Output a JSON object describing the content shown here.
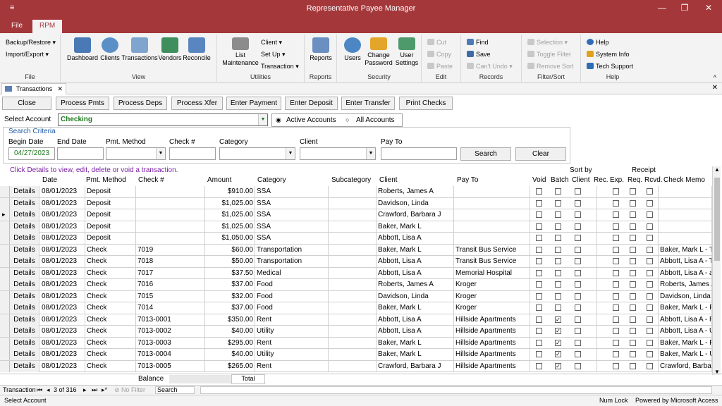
{
  "window": {
    "title": "Representative Payee Manager",
    "qa": "≡"
  },
  "menu": {
    "file": "File",
    "rpm": "RPM"
  },
  "ribbon": {
    "file_group": {
      "backup": "Backup/Restore",
      "import": "Import/Export",
      "label": "File"
    },
    "view_group": {
      "items": [
        "Dashboard",
        "Clients",
        "Transactions",
        "Vendors",
        "Reconcile"
      ],
      "label": "View"
    },
    "utilities_group": {
      "list": "List\nMaintenance",
      "client": "Client",
      "setup": "Set Up",
      "transaction": "Transaction",
      "label": "Utilities"
    },
    "reports_group": {
      "reports": "Reports",
      "label": "Reports"
    },
    "security_group": {
      "users": "Users",
      "change_pw": "Change\nPassword",
      "settings": "User\nSettings",
      "label": "Security"
    },
    "edit_group": {
      "cut": "Cut",
      "copy": "Copy",
      "paste": "Paste",
      "label": "Edit"
    },
    "records_group": {
      "find": "Find",
      "save": "Save",
      "undo": "Can't Undo",
      "label": "Records"
    },
    "filter_group": {
      "selection": "Selection",
      "toggle": "Toggle Filter",
      "remove": "Remove Sort",
      "label": "Filter/Sort"
    },
    "help_group": {
      "help": "Help",
      "sysinfo": "System Info",
      "tech": "Tech Support",
      "label": "Help"
    }
  },
  "doc_tab": "Transactions",
  "buttons": {
    "close": "Close",
    "process_pmts": "Process Pmts",
    "process_deps": "Process Deps",
    "process_xfer": "Process Xfer",
    "enter_payment": "Enter Payment",
    "enter_deposit": "Enter Deposit",
    "enter_transfer": "Enter Transfer",
    "print_checks": "Print Checks",
    "search": "Search",
    "clear": "Clear"
  },
  "account": {
    "label": "Select Account",
    "value": "Checking",
    "active": "Active Accounts",
    "all": "All Accounts"
  },
  "criteria": {
    "title": "Search Criteria",
    "begin_date": "Begin Date",
    "begin_value": "04/27/2023",
    "end_date": "End Date",
    "pmt_method": "Pmt. Method",
    "check_no": "Check #",
    "category": "Category",
    "client": "Client",
    "pay_to": "Pay To"
  },
  "hint": "Click Details to view, edit, delete or void a transaction.",
  "columns": {
    "date": "Date",
    "pmt": "Pmt. Method",
    "check": "Check #",
    "amount": "Amount",
    "category": "Category",
    "subcategory": "Subcategory",
    "client": "Client",
    "payto": "Pay To",
    "void": "Void",
    "batch": "Batch",
    "sortby": "Sort by",
    "sortclient": "Client",
    "rec": "Rec.",
    "exp": "Exp.",
    "receipt": "Receipt",
    "req": "Req.",
    "rcvd": "Rcvd.",
    "memo": "Check Memo"
  },
  "details_label": "Details",
  "rows": [
    {
      "date": "08/01/2023",
      "pmt": "Deposit",
      "check": "",
      "amount": "$910.00",
      "category": "SSA",
      "client": "Roberts, James A",
      "payto": "",
      "batch": false,
      "memo": ""
    },
    {
      "date": "08/01/2023",
      "pmt": "Deposit",
      "check": "",
      "amount": "$1,025.00",
      "category": "SSA",
      "client": "Davidson, Linda",
      "payto": "",
      "batch": false,
      "memo": ""
    },
    {
      "date": "08/01/2023",
      "pmt": "Deposit",
      "check": "",
      "amount": "$1,025.00",
      "category": "SSA",
      "client": "Crawford, Barbara J",
      "payto": "",
      "batch": false,
      "memo": ""
    },
    {
      "date": "08/01/2023",
      "pmt": "Deposit",
      "check": "",
      "amount": "$1,025.00",
      "category": "SSA",
      "client": "Baker, Mark L",
      "payto": "",
      "batch": false,
      "memo": ""
    },
    {
      "date": "08/01/2023",
      "pmt": "Deposit",
      "check": "",
      "amount": "$1,050.00",
      "category": "SSA",
      "client": "Abbott, Lisa A",
      "payto": "",
      "batch": false,
      "memo": ""
    },
    {
      "date": "08/01/2023",
      "pmt": "Check",
      "check": "7019",
      "amount": "$60.00",
      "category": "Transportation",
      "client": "Baker, Mark L",
      "payto": "Transit Bus Service",
      "batch": false,
      "memo": "Baker, Mark L - T"
    },
    {
      "date": "08/01/2023",
      "pmt": "Check",
      "check": "7018",
      "amount": "$50.00",
      "category": "Transportation",
      "client": "Abbott, Lisa A",
      "payto": "Transit Bus Service",
      "batch": false,
      "memo": "Abbott, Lisa A - T"
    },
    {
      "date": "08/01/2023",
      "pmt": "Check",
      "check": "7017",
      "amount": "$37.50",
      "category": "Medical",
      "client": "Abbott, Lisa A",
      "payto": "Memorial Hospital",
      "batch": false,
      "memo": "Abbott, Lisa A - a"
    },
    {
      "date": "08/01/2023",
      "pmt": "Check",
      "check": "7016",
      "amount": "$37.00",
      "category": "Food",
      "client": "Roberts, James A",
      "payto": "Kroger",
      "batch": false,
      "memo": "Roberts, James A"
    },
    {
      "date": "08/01/2023",
      "pmt": "Check",
      "check": "7015",
      "amount": "$32.00",
      "category": "Food",
      "client": "Davidson, Linda",
      "payto": "Kroger",
      "batch": false,
      "memo": "Davidson, Linda"
    },
    {
      "date": "08/01/2023",
      "pmt": "Check",
      "check": "7014",
      "amount": "$37.00",
      "category": "Food",
      "client": "Baker, Mark L",
      "payto": "Kroger",
      "batch": false,
      "memo": "Baker, Mark L - F"
    },
    {
      "date": "08/01/2023",
      "pmt": "Check",
      "check": "7013-0001",
      "amount": "$350.00",
      "category": "Rent",
      "client": "Abbott, Lisa A",
      "payto": "Hillside Apartments",
      "batch": true,
      "memo": "Abbott, Lisa A - R"
    },
    {
      "date": "08/01/2023",
      "pmt": "Check",
      "check": "7013-0002",
      "amount": "$40.00",
      "category": "Utility",
      "client": "Abbott, Lisa A",
      "payto": "Hillside Apartments",
      "batch": true,
      "memo": "Abbott, Lisa A - U"
    },
    {
      "date": "08/01/2023",
      "pmt": "Check",
      "check": "7013-0003",
      "amount": "$295.00",
      "category": "Rent",
      "client": "Baker, Mark L",
      "payto": "Hillside Apartments",
      "batch": true,
      "memo": "Baker, Mark L - R"
    },
    {
      "date": "08/01/2023",
      "pmt": "Check",
      "check": "7013-0004",
      "amount": "$40.00",
      "category": "Utility",
      "client": "Baker, Mark L",
      "payto": "Hillside Apartments",
      "batch": true,
      "memo": "Baker, Mark L - U"
    },
    {
      "date": "08/01/2023",
      "pmt": "Check",
      "check": "7013-0005",
      "amount": "$265.00",
      "category": "Rent",
      "client": "Crawford, Barbara J",
      "payto": "Hillside Apartments",
      "batch": true,
      "memo": "Crawford, Barbar"
    }
  ],
  "footer": {
    "balance": "Balance",
    "total": "Total"
  },
  "nav": {
    "label": "Transaction",
    "record": "3 of 316",
    "nofilter": "No Filter",
    "search": "Search"
  },
  "status": {
    "left": "Select Account",
    "numlock": "Num Lock",
    "powered": "Powered by Microsoft Access"
  },
  "colors": {
    "titlebar": "#a4373a",
    "green_text": "#1e7a1e",
    "hint": "#7a1fa2"
  }
}
